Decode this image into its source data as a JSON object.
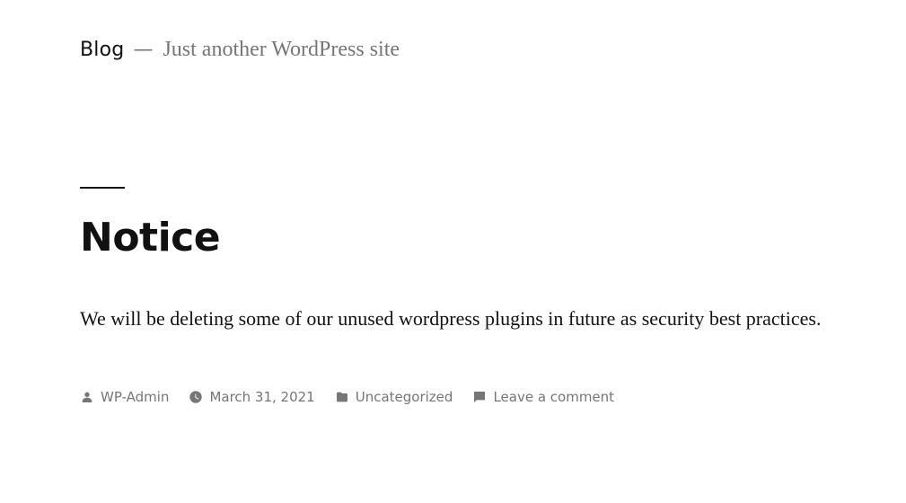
{
  "header": {
    "site_title": "Blog",
    "separator": "—",
    "site_description": "Just another WordPress site"
  },
  "post": {
    "title": "Notice",
    "content": "We will be deleting some of our unused wordpress plugins in future as security best practices.",
    "meta": {
      "author": "WP-Admin",
      "date": "March 31, 2021",
      "category": "Uncategorized",
      "comments": "Leave a comment"
    }
  },
  "icons": {
    "author": "person-icon",
    "date": "clock-icon",
    "category": "folder-icon",
    "comments": "comment-icon"
  },
  "colors": {
    "text": "#111111",
    "muted": "#767676",
    "background": "#ffffff"
  }
}
